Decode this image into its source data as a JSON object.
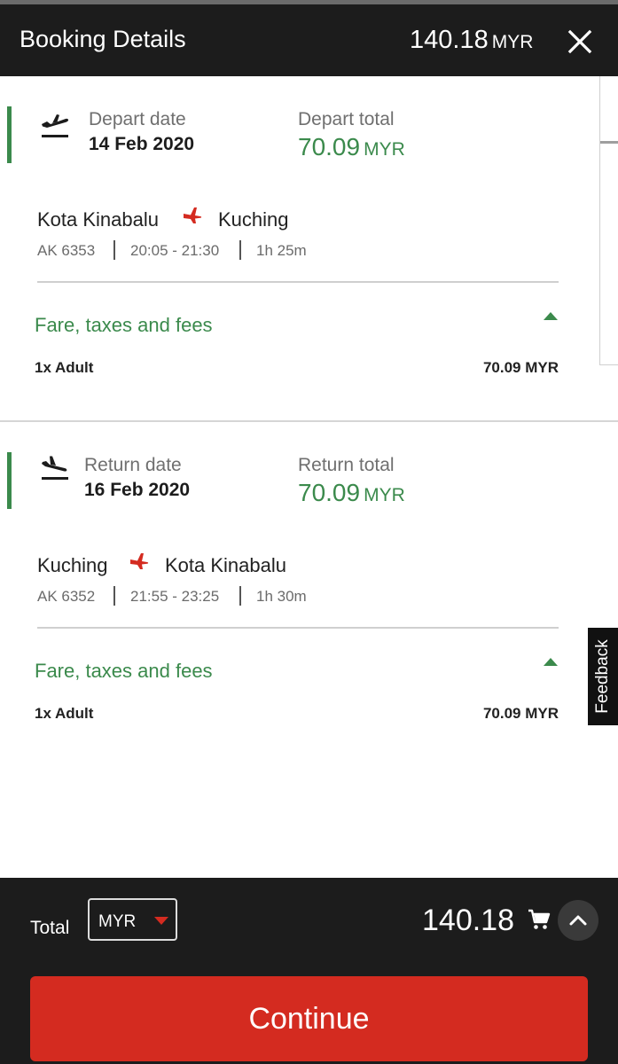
{
  "header": {
    "title": "Booking Details",
    "total_amount": "140.18",
    "total_currency": "MYR"
  },
  "depart": {
    "date_label": "Depart date",
    "date_value": "14 Feb 2020",
    "total_label": "Depart total",
    "total_amount": "70.09",
    "total_currency": "MYR",
    "origin": "Kota Kinabalu",
    "destination": "Kuching",
    "flight_no": "AK 6353",
    "time": "20:05 - 21:30",
    "duration": "1h 25m",
    "fare_title": "Fare, taxes and fees",
    "pax_label": "1x Adult",
    "pax_price": "70.09 MYR"
  },
  "return": {
    "date_label": "Return date",
    "date_value": "16 Feb 2020",
    "total_label": "Return total",
    "total_amount": "70.09",
    "total_currency": "MYR",
    "origin": "Kuching",
    "destination": "Kota Kinabalu",
    "flight_no": "AK 6352",
    "time": "21:55 - 23:25",
    "duration": "1h 30m",
    "fare_title": "Fare, taxes and fees",
    "pax_label": "1x Adult",
    "pax_price": "70.09 MYR"
  },
  "feedback_label": "Feedback",
  "footer": {
    "total_label": "Total",
    "currency": "MYR",
    "grand_total": "140.18",
    "continue_label": "Continue"
  },
  "colors": {
    "accent_green": "#3b8a4c",
    "brand_red": "#d42b20",
    "dark_bar": "#1c1c1c"
  },
  "icons": {
    "close": "close-icon",
    "depart": "flight-takeoff-icon",
    "return": "flight-land-icon",
    "airline": "airline-plane-icon",
    "collapse": "caret-up-icon",
    "cart": "cart-icon",
    "expand": "chevron-up-icon"
  }
}
